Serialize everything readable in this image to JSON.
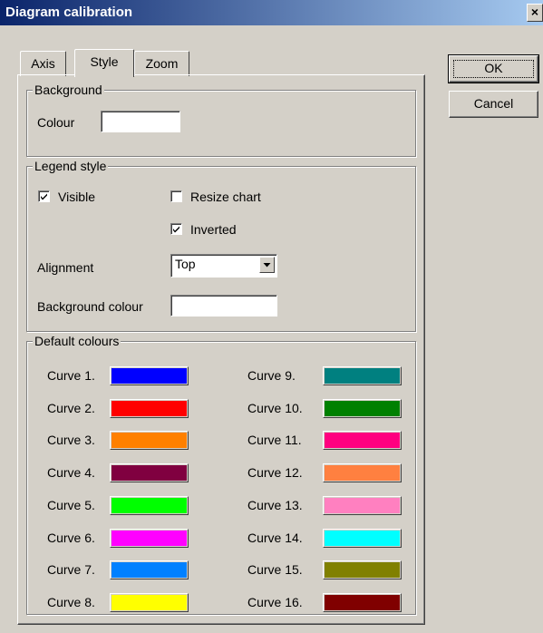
{
  "window": {
    "title": "Diagram calibration",
    "close_label": "×"
  },
  "tabs": [
    {
      "label": "Axis",
      "active": false
    },
    {
      "label": "Style",
      "active": true
    },
    {
      "label": "Zoom",
      "active": false
    }
  ],
  "buttons": {
    "ok": "OK",
    "cancel": "Cancel"
  },
  "background": {
    "group": "Background",
    "colour_label": "Colour",
    "colour_value": "#ffffff"
  },
  "legend_style": {
    "group": "Legend style",
    "visible_label": "Visible",
    "visible_checked": true,
    "resize_label": "Resize chart",
    "resize_checked": false,
    "inverted_label": "Inverted",
    "inverted_checked": true,
    "alignment_label": "Alignment",
    "alignment_value": "Top",
    "bgcolour_label": "Background colour",
    "bgcolour_value": "#ffffff"
  },
  "default_colours": {
    "group": "Default colours",
    "curves": [
      {
        "label": "Curve 1.",
        "color": "#0000ff"
      },
      {
        "label": "Curve 2.",
        "color": "#ff0000"
      },
      {
        "label": "Curve 3.",
        "color": "#ff8000"
      },
      {
        "label": "Curve 4.",
        "color": "#800040"
      },
      {
        "label": "Curve 5.",
        "color": "#00ff00"
      },
      {
        "label": "Curve 6.",
        "color": "#ff00ff"
      },
      {
        "label": "Curve 7.",
        "color": "#0080ff"
      },
      {
        "label": "Curve 8.",
        "color": "#ffff00"
      },
      {
        "label": "Curve 9.",
        "color": "#008080"
      },
      {
        "label": "Curve 10.",
        "color": "#008000"
      },
      {
        "label": "Curve 11.",
        "color": "#ff0080"
      },
      {
        "label": "Curve 12.",
        "color": "#ff8040"
      },
      {
        "label": "Curve 13.",
        "color": "#ff80c0"
      },
      {
        "label": "Curve 14.",
        "color": "#00ffff"
      },
      {
        "label": "Curve 15.",
        "color": "#808000"
      },
      {
        "label": "Curve 16.",
        "color": "#800000"
      }
    ]
  }
}
